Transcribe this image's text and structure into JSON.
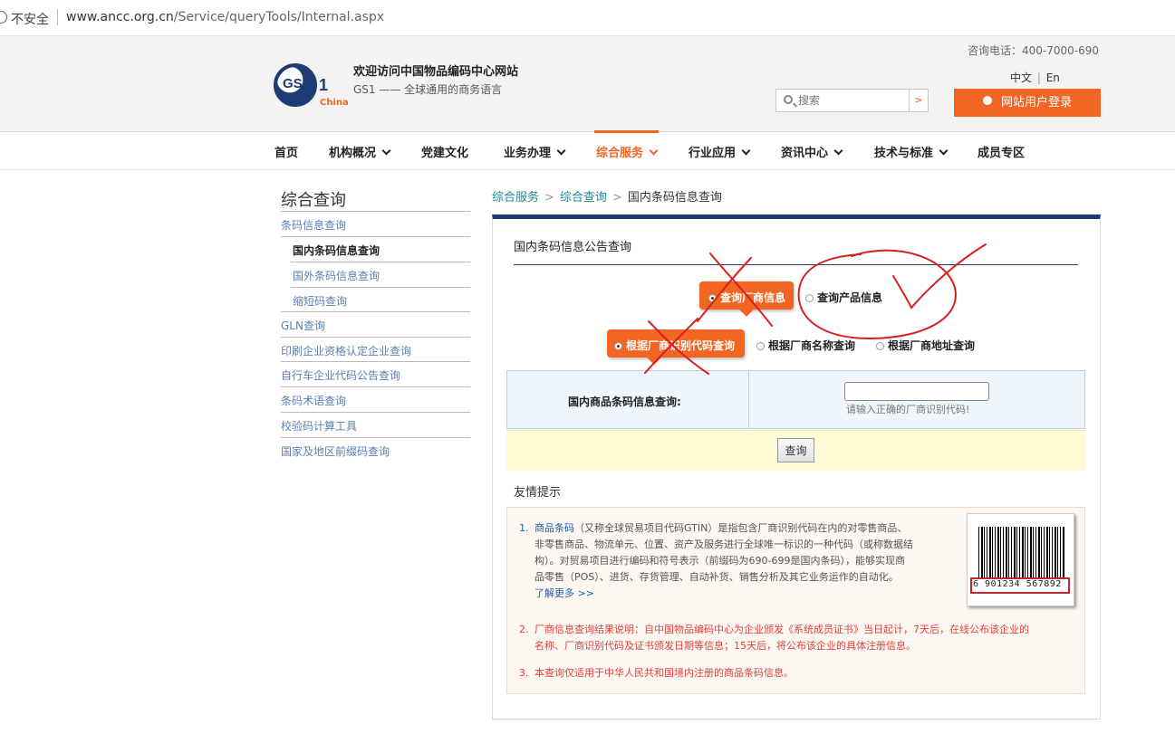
{
  "browser": {
    "security_label": "不安全",
    "url_domain": "www.ancc.org.cn",
    "url_path": "/Service/queryTools/Internal.aspx"
  },
  "header": {
    "logo_text": "GS1",
    "logo_china": "China",
    "site_title": "欢迎访问中国物品编码中心网站",
    "site_subtitle": "GS1 —— 全球通用的商务语言",
    "phone": "咨询电话：400-7000-690",
    "lang_cn": "中文",
    "lang_sep": "|",
    "lang_en": "En",
    "search_placeholder": "搜索",
    "search_go": ">",
    "login_label": "网站用户登录"
  },
  "nav": {
    "items": [
      {
        "label": "首页"
      },
      {
        "label": "机构概况"
      },
      {
        "label": "党建文化"
      },
      {
        "label": "业务办理"
      },
      {
        "label": "综合服务"
      },
      {
        "label": "行业应用"
      },
      {
        "label": "资讯中心"
      },
      {
        "label": "技术与标准"
      },
      {
        "label": "成员专区"
      }
    ]
  },
  "sidebar": {
    "title": "综合查询",
    "items": [
      {
        "label": "条码信息查询"
      },
      {
        "label": "国内条码信息查询"
      },
      {
        "label": "国外条码信息查询"
      },
      {
        "label": "缩短码查询"
      },
      {
        "label": "GLN查询"
      },
      {
        "label": "印刷企业资格认定企业查询"
      },
      {
        "label": "自行车企业代码公告查询"
      },
      {
        "label": "条码术语查询"
      },
      {
        "label": "校验码计算工具"
      },
      {
        "label": "国家及地区前缀码查询"
      }
    ]
  },
  "breadcrumb": {
    "items": [
      "综合服务",
      "综合查询",
      "国内条码信息查询"
    ],
    "separator": ">"
  },
  "main": {
    "title": "国内条码信息公告查询",
    "query_type": {
      "manufacturer": "查询厂商信息",
      "product": "查询产品信息"
    },
    "query_by": {
      "code": "根据厂商识别代码查询",
      "name": "根据厂商名称查询",
      "address": "根据厂商地址查询"
    },
    "form_label": "国内商品条码信息查询:",
    "form_value": "",
    "form_hint": "请输入正确的厂商识别代码!",
    "submit_label": "查询"
  },
  "tips": {
    "title": "友情提示",
    "items": [
      {
        "num": "1.",
        "highlight": "商品条码",
        "line1": "（又称全球贸易项目代码GTIN）是指包含厂商识别代码在内的对零售商品、",
        "line2": "非零售商品、物流单元、位置、资产及服务进行全球唯一标识的一种代码（或称数据结",
        "line3": "构）。对贸易项目进行编码和符号表示（前缀码为690-699是国内条码），能够实现商",
        "line4": "品零售（POS）、进货、存货管理、自动补货、销售分析及其它业务运作的自动化。",
        "more": "了解更多 >>"
      },
      {
        "num": "2.",
        "line1": "厂商信息查询结果说明：自中国物品编码中心为企业颁发《系统成员证书》当日起计，7天后，在线公布该企业的",
        "line2": "名称、厂商识别代码及证书颁发日期等信息；15天后，将公布该企业的具体注册信息。"
      },
      {
        "num": "3.",
        "line1": "本查询仅适用于中华人民共和国境内注册的商品条码信息。"
      }
    ],
    "barcode_digits": "6 901234 567892"
  },
  "colors": {
    "accent": "#f26522",
    "brand_navy": "#1d3b74",
    "link": "#5b7fb0",
    "annotation_red": "#d9201e"
  }
}
